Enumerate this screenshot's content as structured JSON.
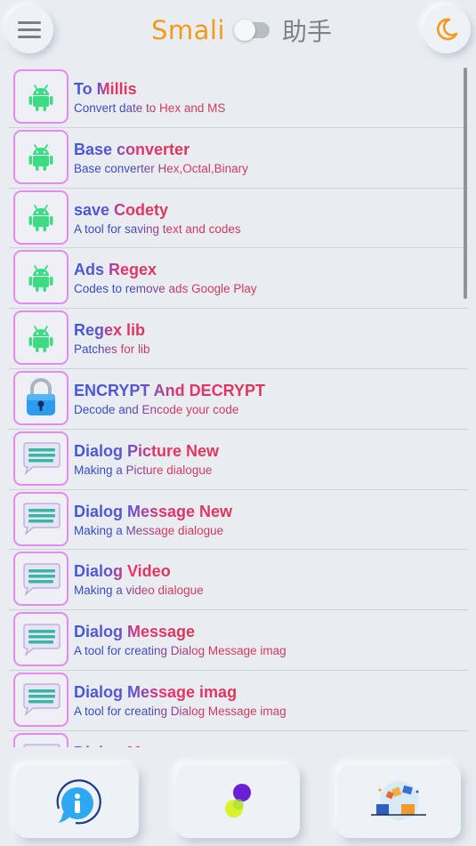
{
  "header": {
    "title_left": "Smali",
    "title_right": "助手",
    "menu_icon": "hamburger-menu-icon",
    "theme_icon": "moon-icon",
    "toggle_state": "off"
  },
  "items": [
    {
      "title": "To Millis",
      "subtitle": "Convert date to Hex and MS",
      "icon": "android"
    },
    {
      "title": "Base converter",
      "subtitle": "Base converter Hex,Octal,Binary",
      "icon": "android"
    },
    {
      "title": "save Codety",
      "subtitle": "A tool for saving text and codes",
      "icon": "android"
    },
    {
      "title": "Ads Regex",
      "subtitle": "Codes to remove ads Google Play",
      "icon": "android"
    },
    {
      "title": "Regex lib",
      "subtitle": "Patches for lib",
      "icon": "android"
    },
    {
      "title": "ENCRYPT And DECRYPT",
      "subtitle": "Decode and Encode your code",
      "icon": "lock"
    },
    {
      "title": "Dialog Picture New",
      "subtitle": "Making a Picture dialogue",
      "icon": "chat"
    },
    {
      "title": "Dialog Message New",
      "subtitle": "Making a Message dialogue",
      "icon": "chat"
    },
    {
      "title": "Dialog Video",
      "subtitle": "Making a video dialogue",
      "icon": "chat"
    },
    {
      "title": "Dialog Message",
      "subtitle": "A tool for creating Dialog Message imag",
      "icon": "chat"
    },
    {
      "title": "Dialog Message imag",
      "subtitle": "A tool for creating Dialog Message imag",
      "icon": "chat"
    },
    {
      "title": "Dialog M",
      "subtitle": "",
      "icon": "chat"
    }
  ],
  "bottom_bar": {
    "buttons": [
      "info-icon",
      "color-dots-icon",
      "boxes-illustration-icon"
    ]
  },
  "colors": {
    "accent_orange": "#f39a1c",
    "icon_border": "#e38bf2",
    "title_blue": "#4257d9",
    "title_red": "#e8336b",
    "android_green": "#3ddc84"
  }
}
